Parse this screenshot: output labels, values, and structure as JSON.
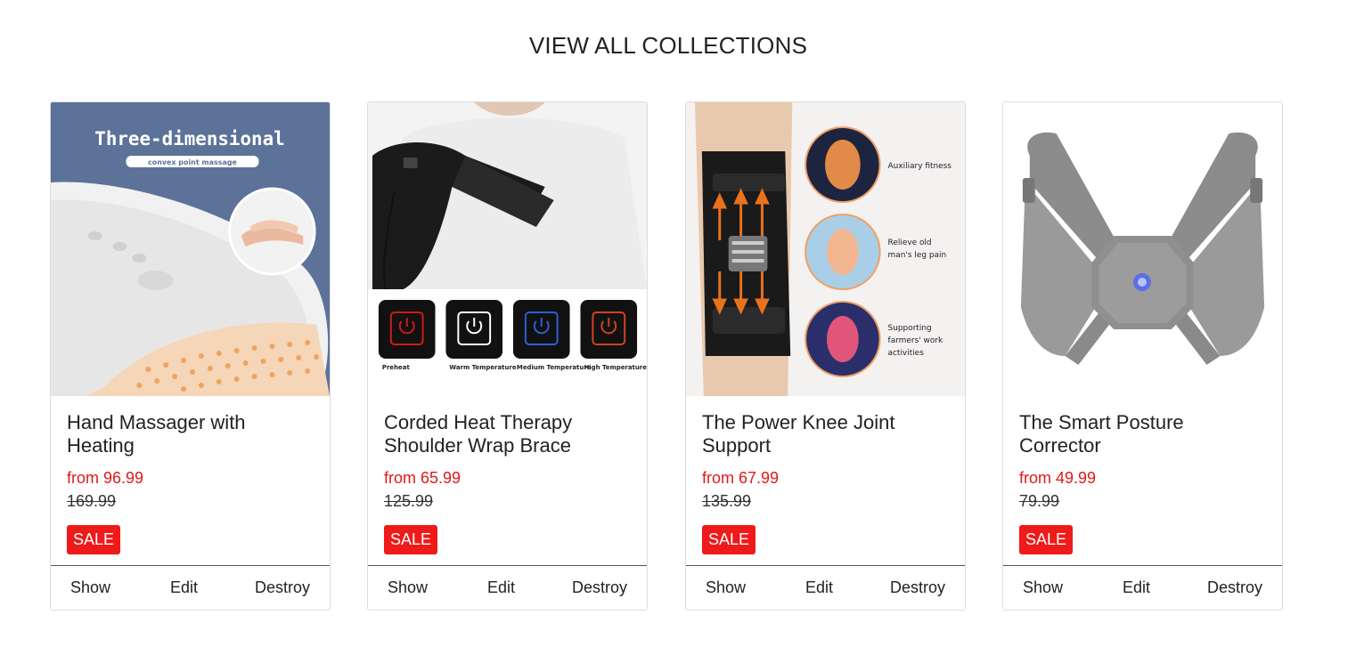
{
  "page": {
    "title": "VIEW ALL COLLECTIONS"
  },
  "products": [
    {
      "title": "Hand Massager with Heating",
      "price": "from 96.99",
      "compare_price": "169.99",
      "badge": "SALE",
      "image_text": {
        "headline": "Three-dimensional",
        "sub": "convex point massage"
      },
      "actions": {
        "show": "Show",
        "edit": "Edit",
        "destroy": "Destroy"
      }
    },
    {
      "title": "Corded Heat Therapy Shoulder Wrap Brace",
      "price": "from 65.99",
      "compare_price": "125.99",
      "badge": "SALE",
      "image_text": {
        "modes": [
          "Preheat",
          "Warm Temperature",
          "Medium Temperature",
          "High Temperature"
        ]
      },
      "actions": {
        "show": "Show",
        "edit": "Edit",
        "destroy": "Destroy"
      }
    },
    {
      "title": "The Power Knee Joint Support",
      "price": "from 67.99",
      "compare_price": "135.99",
      "badge": "SALE",
      "image_text": {
        "features": [
          "Auxiliary fitness",
          "Relieve old man's leg pain",
          "Supporting farmers' work activities"
        ]
      },
      "actions": {
        "show": "Show",
        "edit": "Edit",
        "destroy": "Destroy"
      }
    },
    {
      "title": "The Smart Posture Corrector",
      "price": "from 49.99",
      "compare_price": "79.99",
      "badge": "SALE",
      "image_text": {},
      "actions": {
        "show": "Show",
        "edit": "Edit",
        "destroy": "Destroy"
      }
    }
  ],
  "colors": {
    "sale": "#ef1a1a",
    "price": "#e01919",
    "border": "#dddddd",
    "text": "#222222"
  }
}
